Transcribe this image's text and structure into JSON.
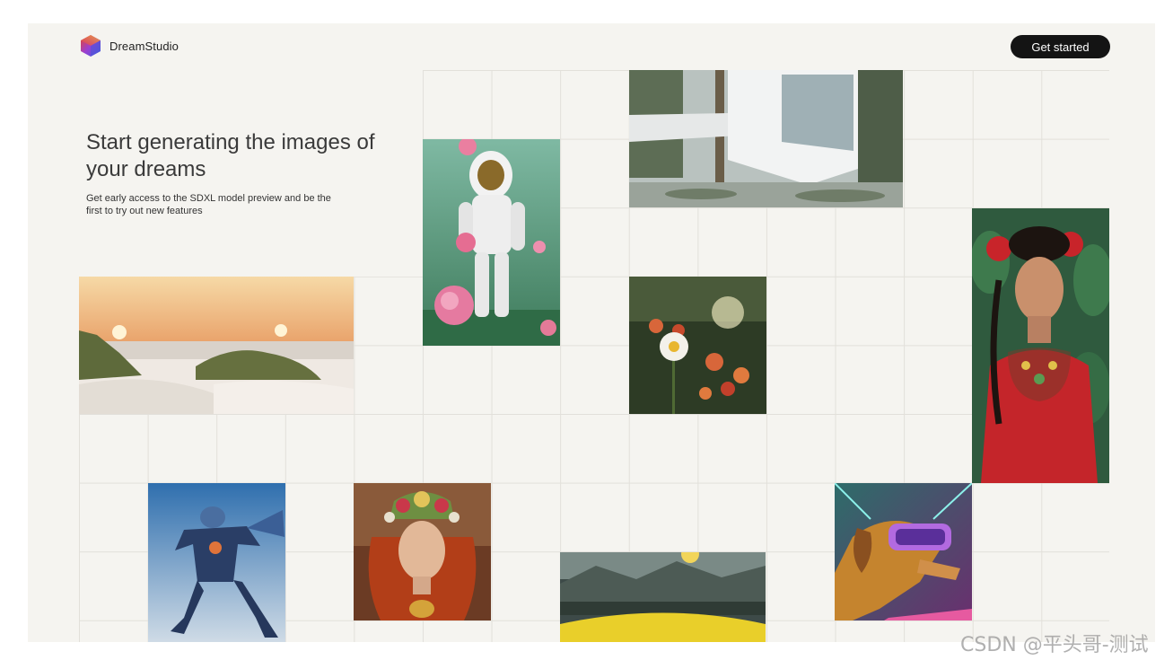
{
  "header": {
    "brand_name": "DreamStudio",
    "logo_icon": "hexagon-gradient-logo-icon",
    "cta_label": "Get started"
  },
  "hero": {
    "title": "Start generating the images of your dreams",
    "subtitle": "Get early access to the SDXL model preview and be the first to try out new features"
  },
  "gallery": [
    {
      "name": "astronaut-roses-image"
    },
    {
      "name": "modern-house-image"
    },
    {
      "name": "frida-portrait-image"
    },
    {
      "name": "beach-dunes-image"
    },
    {
      "name": "daisy-flower-image"
    },
    {
      "name": "robot-warrior-image"
    },
    {
      "name": "flower-crown-woman-image"
    },
    {
      "name": "yellow-field-landscape-image"
    },
    {
      "name": "vr-dog-image"
    }
  ],
  "watermark": "CSDN @平头哥-测试",
  "colors": {
    "page_background": "#f5f4f0",
    "grid_line": "#e2e0da",
    "cta_background": "#141414",
    "cta_text": "#ffffff"
  }
}
